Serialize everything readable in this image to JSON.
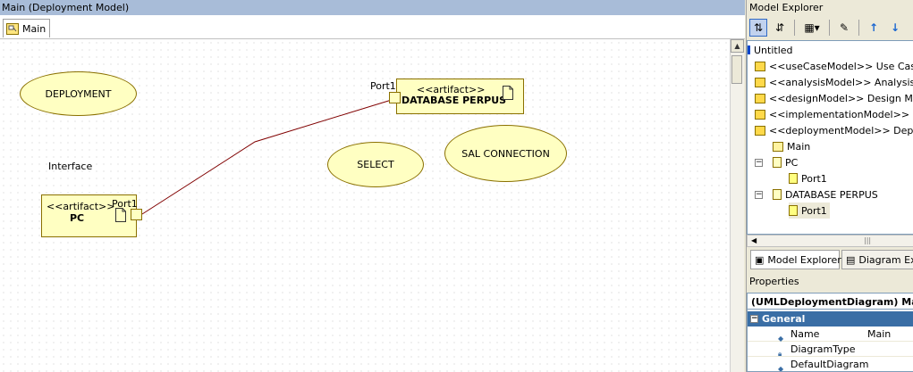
{
  "left_panel": {
    "title": "Main (Deployment Model)",
    "tab_label": "Main"
  },
  "diagram": {
    "ellipses": [
      "DEPLOYMENT",
      "SELECT",
      "SAL CONNECTION"
    ],
    "interface_label": "Interface",
    "artifact_pc": {
      "stereotype": "<<artifact>>",
      "name": "PC",
      "port": "Port1"
    },
    "artifact_db": {
      "stereotype": "<<artifact>>",
      "name": "DATABASE PERPUS",
      "port": "Port1"
    },
    "line_color": "#800000",
    "fill_color": "#ffffc2"
  },
  "model_explorer": {
    "title": "Model Explorer",
    "root": "Untitled",
    "nodes": [
      "<<useCaseModel>> Use Case Model",
      "<<analysisModel>> Analysis Model",
      "<<designModel>> Design Model",
      "<<implementationModel>> Implementation Model",
      "<<deploymentModel>> Deployment Model"
    ],
    "children": [
      "Main",
      "PC",
      "Port1",
      "DATABASE PERPUS",
      "Port1"
    ],
    "tabs": [
      "Model Explorer",
      "Diagram Explorer"
    ]
  },
  "properties": {
    "title": "Properties",
    "header": "(UMLDeploymentDiagram) Main",
    "category": "General",
    "rows": [
      {
        "name": "Name",
        "value": "Main"
      },
      {
        "name": "DiagramType",
        "value": ""
      },
      {
        "name": "DefaultDiagram",
        "value": ""
      }
    ]
  },
  "colors": {
    "title_bar": "#a8bcd8",
    "selection": "#3a6ea5"
  }
}
